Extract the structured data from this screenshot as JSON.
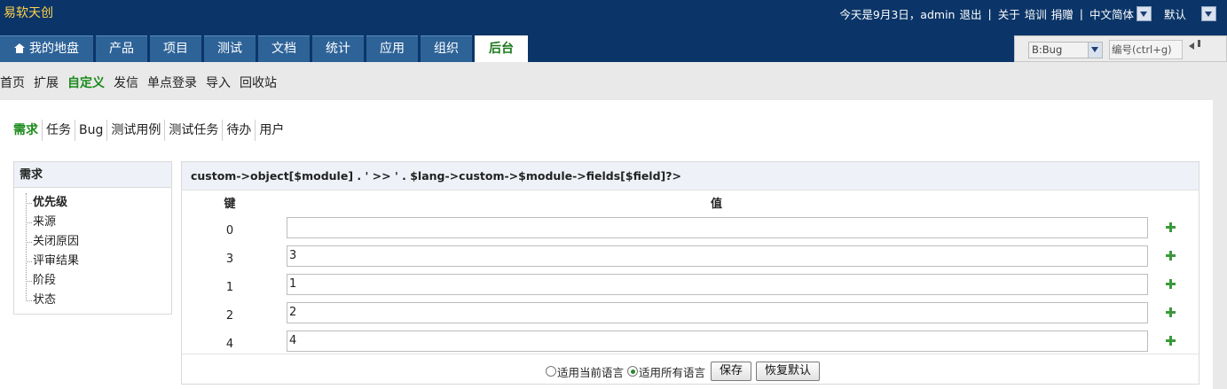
{
  "app": {
    "brand": "易软天创",
    "status_text": "今天是9月3日，admin",
    "logout": "退出",
    "about": "关于",
    "training": "培训",
    "donate": "捐赠",
    "language": "中文简体",
    "theme": "默认"
  },
  "nav": {
    "tabs": [
      {
        "label": "我的地盘",
        "icon": "home-icon"
      },
      {
        "label": "产品"
      },
      {
        "label": "项目"
      },
      {
        "label": "测试"
      },
      {
        "label": "文档"
      },
      {
        "label": "统计"
      },
      {
        "label": "应用"
      },
      {
        "label": "组织"
      },
      {
        "label": "后台",
        "active": true
      }
    ]
  },
  "search": {
    "type_selected": "B:Bug",
    "placeholder": "编号(ctrl+g)",
    "go_icon": "return-icon"
  },
  "submenu": {
    "items": [
      "首页",
      "扩展",
      "自定义",
      "发信",
      "单点登录",
      "导入",
      "回收站"
    ],
    "active": "自定义"
  },
  "module_tabs": {
    "items": [
      "需求",
      "任务",
      "Bug",
      "测试用例",
      "测试任务",
      "待办",
      "用户"
    ],
    "active": "需求"
  },
  "tree": {
    "title": "需求",
    "items": [
      "优先级",
      "来源",
      "关闭原因",
      "评审结果",
      "阶段",
      "状态"
    ],
    "active": "优先级"
  },
  "editor": {
    "title": "custom->object[$module] . ' >> ' . $lang->custom->$module->fields[$field]?>",
    "key_header": "键",
    "value_header": "值",
    "rows": [
      {
        "key": "0",
        "value": ""
      },
      {
        "key": "3",
        "value": "3"
      },
      {
        "key": "1",
        "value": "1"
      },
      {
        "key": "2",
        "value": "2"
      },
      {
        "key": "4",
        "value": "4"
      }
    ],
    "lang_current": "适用当前语言",
    "lang_all": "适用所有语言",
    "lang_selected": "all",
    "save_label": "保存",
    "reset_label": "恢复默认"
  },
  "colors": {
    "header_bg": "#0b3568",
    "tab_bg": "#2e6398",
    "accent_green": "#1a8a1a",
    "brand_yellow": "#ffd24a"
  }
}
